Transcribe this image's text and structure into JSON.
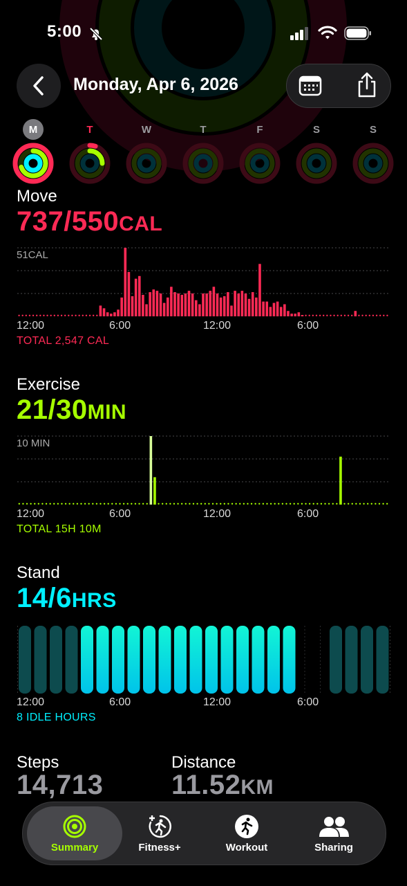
{
  "status_bar": {
    "time": "5:00"
  },
  "nav": {
    "date": "Monday, Apr 6, 2026"
  },
  "week": {
    "days": [
      {
        "letter": "M",
        "move": 1.34,
        "exercise": 0.7,
        "stand": 1.0
      },
      {
        "letter": "T",
        "move": 0.05,
        "exercise": 0.25,
        "stand": 0.0
      },
      {
        "letter": "W",
        "move": 0,
        "exercise": 0,
        "stand": 0
      },
      {
        "letter": "T",
        "move": 0,
        "exercise": 0,
        "stand": 0
      },
      {
        "letter": "F",
        "move": 0,
        "exercise": 0,
        "stand": 0
      },
      {
        "letter": "S",
        "move": 0,
        "exercise": 0,
        "stand": 0
      },
      {
        "letter": "S",
        "move": 0,
        "exercise": 0,
        "stand": 0
      }
    ]
  },
  "move": {
    "label": "Move",
    "value": "737/550",
    "unit": "CAL",
    "scale_label": "51CAL",
    "ticks": [
      "12:00",
      "6:00",
      "12:00",
      "6:00"
    ],
    "total": "TOTAL 2,547 CAL"
  },
  "exercise": {
    "label": "Exercise",
    "value": "21/30",
    "unit": "MIN",
    "scale_label": "10 MIN",
    "ticks": [
      "12:00",
      "6:00",
      "12:00",
      "6:00"
    ],
    "total": "TOTAL 15H 10M"
  },
  "stand": {
    "label": "Stand",
    "value": "14/6",
    "unit": "HRS",
    "ticks": [
      "12:00",
      "6:00",
      "12:00",
      "6:00"
    ],
    "total": "8 IDLE HOURS"
  },
  "steps": {
    "label": "Steps",
    "value": "14,713"
  },
  "distance": {
    "label": "Distance",
    "value": "11.52",
    "unit": "KM"
  },
  "tabs": [
    {
      "label": "Summary",
      "icon": "summary-rings-icon"
    },
    {
      "label": "Fitness+",
      "icon": "fitness-plus-icon"
    },
    {
      "label": "Workout",
      "icon": "workout-runner-icon"
    },
    {
      "label": "Sharing",
      "icon": "sharing-people-icon"
    }
  ],
  "colors": {
    "move": "#ff2a55",
    "exercise": "#a6ff00",
    "stand": "#00f0ff"
  },
  "chart_data": [
    {
      "type": "bar",
      "title": "Move",
      "ylabel": "51CAL",
      "x_unit": "5-min interval across 24h",
      "series": [
        {
          "name": "Move",
          "values": [
            0,
            0,
            0,
            0,
            0,
            0,
            0,
            0,
            0,
            0,
            0,
            0,
            0,
            0,
            0,
            0,
            0,
            0,
            0,
            0,
            0,
            0,
            0,
            8,
            6,
            3,
            2,
            3,
            5,
            14,
            51,
            33,
            15,
            28,
            30,
            16,
            9,
            18,
            20,
            19,
            17,
            10,
            14,
            22,
            18,
            17,
            16,
            17,
            19,
            17,
            12,
            9,
            17,
            17,
            19,
            22,
            17,
            14,
            15,
            18,
            8,
            19,
            17,
            19,
            17,
            13,
            18,
            14,
            39,
            11,
            11,
            7,
            10,
            11,
            7,
            9,
            4,
            2,
            2,
            3,
            1,
            0,
            0,
            0,
            0,
            0,
            0,
            0,
            0,
            0,
            0,
            0,
            0,
            0,
            0,
            4,
            0,
            0,
            0,
            0,
            0,
            0,
            0,
            0,
            0
          ]
        }
      ]
    },
    {
      "type": "bar",
      "title": "Exercise",
      "ylabel": "10 MIN",
      "x_unit": "5-min interval across 24h",
      "series": [
        {
          "name": "Exercise",
          "values": [
            {
              "i": 34,
              "v": 10
            },
            {
              "i": 35,
              "v": 4
            },
            {
              "i": 83,
              "v": 7
            }
          ]
        }
      ]
    },
    {
      "type": "bar",
      "title": "Stand",
      "x_unit": "hour",
      "series": [
        {
          "name": "Stand",
          "values": [
            0,
            0,
            0,
            0,
            1,
            1,
            1,
            1,
            1,
            1,
            1,
            1,
            1,
            1,
            1,
            1,
            1,
            1,
            0,
            0,
            0,
            0,
            0,
            0
          ]
        }
      ]
    }
  ]
}
